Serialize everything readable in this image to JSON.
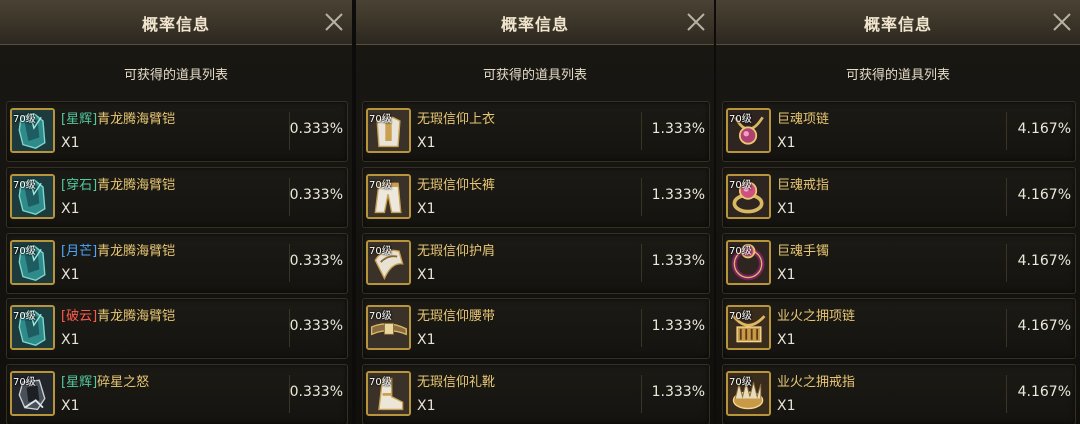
{
  "panels": [
    {
      "title": "概率信息",
      "subtitle": "可获得的道具列表",
      "items": [
        {
          "level": "70级",
          "tag": "[星辉]",
          "tag_color": "#52c9a0",
          "name": "青龙腾海臂铠",
          "qty": "X1",
          "prob": "0.333%",
          "icon": "teal-armor-icon"
        },
        {
          "level": "70级",
          "tag": "[穿石]",
          "tag_color": "#52c9a0",
          "name": "青龙腾海臂铠",
          "qty": "X1",
          "prob": "0.333%",
          "icon": "teal-armor-icon"
        },
        {
          "level": "70级",
          "tag": "[月芒]",
          "tag_color": "#4aa8ff",
          "name": "青龙腾海臂铠",
          "qty": "X1",
          "prob": "0.333%",
          "icon": "teal-armor-icon"
        },
        {
          "level": "70级",
          "tag": "[破云]",
          "tag_color": "#ff5a4a",
          "name": "青龙腾海臂铠",
          "qty": "X1",
          "prob": "0.333%",
          "icon": "teal-armor-icon"
        },
        {
          "level": "70级",
          "tag": "[星辉]",
          "tag_color": "#52c9a0",
          "name": "碎星之怒",
          "qty": "X1",
          "prob": "0.333%",
          "icon": "dark-gauntlet-icon"
        }
      ]
    },
    {
      "title": "概率信息",
      "subtitle": "可获得的道具列表",
      "items": [
        {
          "level": "70级",
          "tag": "",
          "tag_color": "#e8c774",
          "name": "无瑕信仰上衣",
          "qty": "X1",
          "prob": "1.333%",
          "icon": "white-robe-icon"
        },
        {
          "level": "70级",
          "tag": "",
          "tag_color": "#e8c774",
          "name": "无瑕信仰长裤",
          "qty": "X1",
          "prob": "1.333%",
          "icon": "white-pants-icon"
        },
        {
          "level": "70级",
          "tag": "",
          "tag_color": "#e8c774",
          "name": "无瑕信仰护肩",
          "qty": "X1",
          "prob": "1.333%",
          "icon": "pauldron-icon"
        },
        {
          "level": "70级",
          "tag": "",
          "tag_color": "#e8c774",
          "name": "无瑕信仰腰带",
          "qty": "X1",
          "prob": "1.333%",
          "icon": "belt-icon"
        },
        {
          "level": "70级",
          "tag": "",
          "tag_color": "#e8c774",
          "name": "无瑕信仰礼靴",
          "qty": "X1",
          "prob": "1.333%",
          "icon": "boot-icon"
        }
      ]
    },
    {
      "title": "概率信息",
      "subtitle": "可获得的道具列表",
      "items": [
        {
          "level": "70级",
          "tag": "",
          "tag_color": "#e8c774",
          "name": "巨魂项链",
          "qty": "X1",
          "prob": "4.167%",
          "icon": "gem-necklace-icon"
        },
        {
          "level": "70级",
          "tag": "",
          "tag_color": "#e8c774",
          "name": "巨魂戒指",
          "qty": "X1",
          "prob": "4.167%",
          "icon": "gem-ring-icon"
        },
        {
          "level": "70级",
          "tag": "",
          "tag_color": "#e8c774",
          "name": "巨魂手镯",
          "qty": "X1",
          "prob": "4.167%",
          "icon": "gem-bracelet-icon"
        },
        {
          "level": "70级",
          "tag": "",
          "tag_color": "#e8c774",
          "name": "业火之拥项链",
          "qty": "X1",
          "prob": "4.167%",
          "icon": "gold-necklace-icon"
        },
        {
          "level": "70级",
          "tag": "",
          "tag_color": "#e8c774",
          "name": "业火之拥戒指",
          "qty": "X1",
          "prob": "4.167%",
          "icon": "gold-ring-icon"
        }
      ]
    }
  ]
}
